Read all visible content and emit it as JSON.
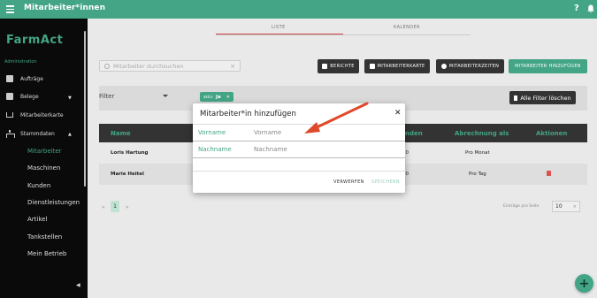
{
  "topbar": {
    "title": "Mitarbeiter*innen"
  },
  "sidebar": {
    "brand": "FarmAct",
    "section": "Administration",
    "items": [
      {
        "label": "Aufträge",
        "icon": "clipboard-icon"
      },
      {
        "label": "Belege",
        "icon": "document-icon"
      },
      {
        "label": "Mitarbeiterkarte",
        "icon": "map-icon"
      },
      {
        "label": "Stammdaten",
        "icon": "tree-icon"
      }
    ],
    "subitems": [
      "Mitarbeiter",
      "Maschinen",
      "Kunden",
      "Dienstleistungen",
      "Artikel",
      "Tankstellen",
      "Mein Betrieb"
    ]
  },
  "tabs": [
    {
      "label": "LISTE"
    },
    {
      "label": "KALENDER"
    }
  ],
  "search": {
    "placeholder": "Mitarbeiter durchsuchen"
  },
  "toolbar": {
    "reports": "BERICHTE",
    "employee_map": "MITARBEITERKARTE",
    "employee_times": "MITARBEITERZEITEN",
    "add_employee": "MITARBEITER HINZUFÜGEN"
  },
  "filter": {
    "label": "Filter",
    "chip_key": "aktiv:",
    "chip_value": "Ja",
    "clear": "Alle Filter löschen"
  },
  "table": {
    "headers": {
      "name": "Name",
      "hours": "unden",
      "billing": "Abrechnung als",
      "actions": "Aktionen"
    },
    "rows": [
      {
        "name": "Loris Hartung",
        "hours": "70",
        "billing": "Pro Monat"
      },
      {
        "name": "Marie Heitel",
        "hours": "00",
        "billing": "Pro Tag"
      }
    ]
  },
  "pagination": {
    "current": "1",
    "per_page_label": "Einträge pro Seite",
    "per_page": "10"
  },
  "dialog": {
    "title": "Mitarbeiter*in hinzufügen",
    "firstname_label": "Vorname",
    "firstname_placeholder": "Vorname",
    "lastname_label": "Nachname",
    "lastname_placeholder": "Nachname",
    "discard": "VERWERFEN",
    "save": "SPEICHERN"
  },
  "colors": {
    "accent": "#43a486",
    "dark": "#333333",
    "annotation_arrow": "#e0482c"
  }
}
